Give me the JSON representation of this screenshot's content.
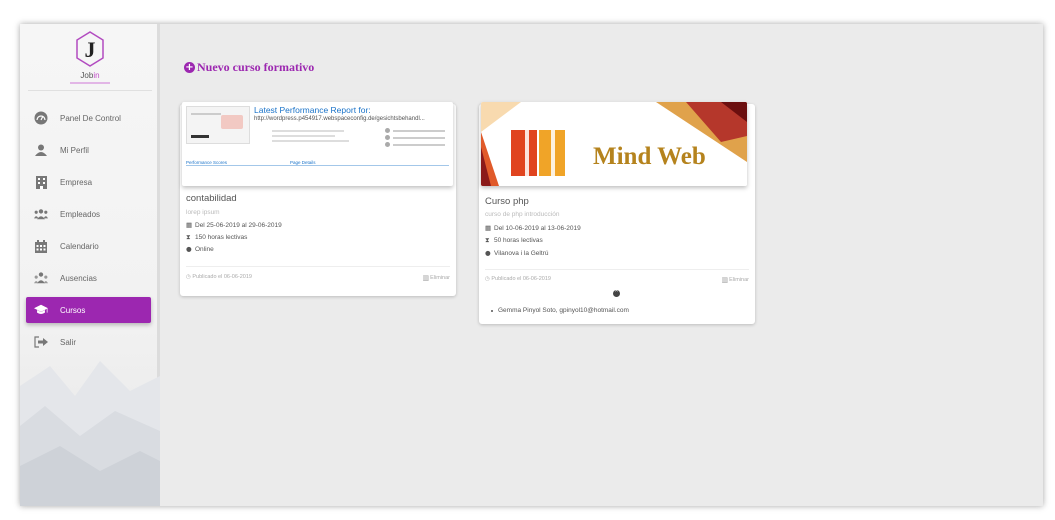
{
  "brand": {
    "name_prefix": "Job",
    "name_highlight": "in"
  },
  "nav": [
    {
      "label": "Panel De Control",
      "icon": "dashboard-icon",
      "active": false
    },
    {
      "label": "Mi Perfil",
      "icon": "person-icon",
      "active": false
    },
    {
      "label": "Empresa",
      "icon": "building-icon",
      "active": false
    },
    {
      "label": "Empleados",
      "icon": "people-icon",
      "active": false
    },
    {
      "label": "Calendario",
      "icon": "calendar-icon",
      "active": false
    },
    {
      "label": "Ausencias",
      "icon": "absences-icon",
      "active": false
    },
    {
      "label": "Cursos",
      "icon": "graduation-cap-icon",
      "active": true
    },
    {
      "label": "Salir",
      "icon": "logout-icon",
      "active": false
    }
  ],
  "new_course_label": "Nuevo curso formativo",
  "courses": [
    {
      "image": {
        "type": "performance-report",
        "title": "Latest Performance Report for:",
        "url": "http://wordpress.p454917.webspaceconfig.de/gesichtsbehandl...",
        "section_scores": "Performance Scores",
        "section_details": "Page Details"
      },
      "title": "contabilidad",
      "subtitle": "lorep ipsum",
      "dates": "Del 25-06-2019 al 29-06-2019",
      "hours": "150 horas lectivas",
      "location": "Online",
      "published": "Publicado el 06-06-2019",
      "delete_label": "Eliminar",
      "attendees": []
    },
    {
      "image": {
        "type": "mind-web-banner",
        "text": "Mind Web"
      },
      "title": "Curso php",
      "subtitle": "curso de php introducción",
      "dates": "Del 10-06-2019 al 13-06-2019",
      "hours": "50 horas lectivas",
      "location": "Vilanova i la Geltrú",
      "published": "Publicado el 06-06-2019",
      "delete_label": "Eliminar",
      "attendees": [
        "Gemma Pinyol Soto, gpinyol10@hotmail.com"
      ]
    }
  ],
  "colors": {
    "accent": "#9c27b0",
    "background": "#ebebeb",
    "sidebar": "#f4f4f4"
  }
}
